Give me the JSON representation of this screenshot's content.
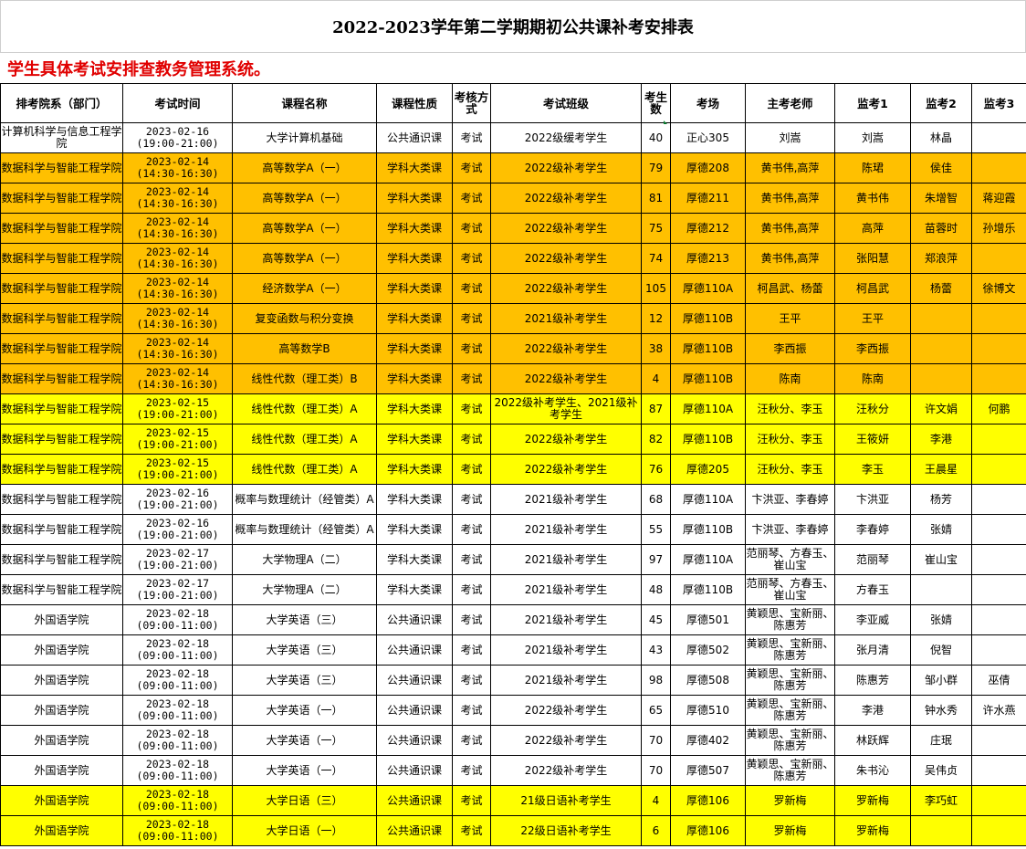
{
  "title": "2022-2023学年第二学期期初公共课补考安排表",
  "notice": "学生具体考试安排查教务管理系统。",
  "headers": [
    "排考院系（部门）",
    "考试时间",
    "课程名称",
    "课程性质",
    "考核方式",
    "考试班级",
    "考生数",
    "考场",
    "主考老师",
    "监考1",
    "监考2",
    "监考3"
  ],
  "rows": [
    {
      "color": "white",
      "dept": "计算机科学与信息工程学院",
      "date": "2023-02-16",
      "time": "(19:00-21:00)",
      "course": "大学计算机基础",
      "nature": "公共通识课",
      "method": "考试",
      "cls": "2022级缓考学生",
      "count": "40",
      "room": "正心305",
      "examiner": "刘嵩",
      "p1": "刘嵩",
      "p2": "林晶",
      "p3": ""
    },
    {
      "color": "orange",
      "dept": "数据科学与智能工程学院",
      "date": "2023-02-14",
      "time": "(14:30-16:30)",
      "course": "高等数学A（一）",
      "nature": "学科大类课",
      "method": "考试",
      "cls": "2022级补考学生",
      "count": "79",
      "room": "厚德208",
      "examiner": "黄书伟,高萍",
      "p1": "陈珺",
      "p2": "侯佳",
      "p3": ""
    },
    {
      "color": "orange",
      "dept": "数据科学与智能工程学院",
      "date": "2023-02-14",
      "time": "(14:30-16:30)",
      "course": "高等数学A（一）",
      "nature": "学科大类课",
      "method": "考试",
      "cls": "2022级补考学生",
      "count": "81",
      "room": "厚德211",
      "examiner": "黄书伟,高萍",
      "p1": "黄书伟",
      "p2": "朱增智",
      "p3": "蒋迎霞"
    },
    {
      "color": "orange",
      "dept": "数据科学与智能工程学院",
      "date": "2023-02-14",
      "time": "(14:30-16:30)",
      "course": "高等数学A（一）",
      "nature": "学科大类课",
      "method": "考试",
      "cls": "2022级补考学生",
      "count": "75",
      "room": "厚德212",
      "examiner": "黄书伟,高萍",
      "p1": "高萍",
      "p2": "苗蓉时",
      "p3": "孙增乐"
    },
    {
      "color": "orange",
      "dept": "数据科学与智能工程学院",
      "date": "2023-02-14",
      "time": "(14:30-16:30)",
      "course": "高等数学A（一）",
      "nature": "学科大类课",
      "method": "考试",
      "cls": "2022级补考学生",
      "count": "74",
      "room": "厚德213",
      "examiner": "黄书伟,高萍",
      "p1": "张阳慧",
      "p2": "郑浪萍",
      "p3": ""
    },
    {
      "color": "orange",
      "dept": "数据科学与智能工程学院",
      "date": "2023-02-14",
      "time": "(14:30-16:30)",
      "course": "经济数学A（一）",
      "nature": "学科大类课",
      "method": "考试",
      "cls": "2022级补考学生",
      "count": "105",
      "room": "厚德110A",
      "examiner": "柯昌武、杨蕾",
      "p1": "柯昌武",
      "p2": "杨蕾",
      "p3": "徐博文"
    },
    {
      "color": "orange",
      "dept": "数据科学与智能工程学院",
      "date": "2023-02-14",
      "time": "(14:30-16:30)",
      "course": "复变函数与积分变换",
      "nature": "学科大类课",
      "method": "考试",
      "cls": "2021级补考学生",
      "count": "12",
      "room": "厚德110B",
      "examiner": "王平",
      "p1": "王平",
      "p2": "",
      "p3": ""
    },
    {
      "color": "orange",
      "dept": "数据科学与智能工程学院",
      "date": "2023-02-14",
      "time": "(14:30-16:30)",
      "course": "高等数学B",
      "nature": "学科大类课",
      "method": "考试",
      "cls": "2022级补考学生",
      "count": "38",
      "room": "厚德110B",
      "examiner": "李西振",
      "p1": "李西振",
      "p2": "",
      "p3": ""
    },
    {
      "color": "orange",
      "dept": "数据科学与智能工程学院",
      "date": "2023-02-14",
      "time": "(14:30-16:30)",
      "course": "线性代数（理工类）B",
      "nature": "学科大类课",
      "method": "考试",
      "cls": "2022级补考学生",
      "count": "4",
      "room": "厚德110B",
      "examiner": "陈南",
      "p1": "陈南",
      "p2": "",
      "p3": ""
    },
    {
      "color": "yellow",
      "dept": "数据科学与智能工程学院",
      "date": "2023-02-15",
      "time": "(19:00-21:00)",
      "course": "线性代数（理工类）A",
      "nature": "学科大类课",
      "method": "考试",
      "cls": "2022级补考学生、2021级补考学生",
      "count": "87",
      "room": "厚德110A",
      "examiner": "汪秋分、李玉",
      "p1": "汪秋分",
      "p2": "许文娟",
      "p3": "何鹏"
    },
    {
      "color": "yellow",
      "dept": "数据科学与智能工程学院",
      "date": "2023-02-15",
      "time": "(19:00-21:00)",
      "course": "线性代数（理工类）A",
      "nature": "学科大类课",
      "method": "考试",
      "cls": "2022级补考学生",
      "count": "82",
      "room": "厚德110B",
      "examiner": "汪秋分、李玉",
      "p1": "王筱妍",
      "p2": "李港",
      "p3": ""
    },
    {
      "color": "yellow",
      "dept": "数据科学与智能工程学院",
      "date": "2023-02-15",
      "time": "(19:00-21:00)",
      "course": "线性代数（理工类）A",
      "nature": "学科大类课",
      "method": "考试",
      "cls": "2022级补考学生",
      "count": "76",
      "room": "厚德205",
      "examiner": "汪秋分、李玉",
      "p1": "李玉",
      "p2": "王晨星",
      "p3": ""
    },
    {
      "color": "white",
      "dept": "数据科学与智能工程学院",
      "date": "2023-02-16",
      "time": "(19:00-21:00)",
      "course": "概率与数理统计（经管类）A",
      "nature": "学科大类课",
      "method": "考试",
      "cls": "2021级补考学生",
      "count": "68",
      "room": "厚德110A",
      "examiner": "卞洪亚、李春婷",
      "p1": "卞洪亚",
      "p2": "杨芳",
      "p3": ""
    },
    {
      "color": "white",
      "dept": "数据科学与智能工程学院",
      "date": "2023-02-16",
      "time": "(19:00-21:00)",
      "course": "概率与数理统计（经管类）A",
      "nature": "学科大类课",
      "method": "考试",
      "cls": "2021级补考学生",
      "count": "55",
      "room": "厚德110B",
      "examiner": "卞洪亚、李春婷",
      "p1": "李春婷",
      "p2": "张婧",
      "p3": ""
    },
    {
      "color": "white",
      "dept": "数据科学与智能工程学院",
      "date": "2023-02-17",
      "time": "(19:00-21:00)",
      "course": "大学物理A（二）",
      "nature": "学科大类课",
      "method": "考试",
      "cls": "2021级补考学生",
      "count": "97",
      "room": "厚德110A",
      "examiner": "范丽琴、方春玉、崔山宝",
      "p1": "范丽琴",
      "p2": "崔山宝",
      "p3": ""
    },
    {
      "color": "white",
      "dept": "数据科学与智能工程学院",
      "date": "2023-02-17",
      "time": "(19:00-21:00)",
      "course": "大学物理A（二）",
      "nature": "学科大类课",
      "method": "考试",
      "cls": "2021级补考学生",
      "count": "48",
      "room": "厚德110B",
      "examiner": "范丽琴、方春玉、崔山宝",
      "p1": "方春玉",
      "p2": "",
      "p3": ""
    },
    {
      "color": "white",
      "dept": "外国语学院",
      "date": "2023-02-18",
      "time": "(09:00-11:00)",
      "course": "大学英语（三）",
      "nature": "公共通识课",
      "method": "考试",
      "cls": "2021级补考学生",
      "count": "45",
      "room": "厚德501",
      "examiner": "黄颖思、宝新丽、陈惠芳",
      "p1": "李亚威",
      "p2": "张婧",
      "p3": ""
    },
    {
      "color": "white",
      "dept": "外国语学院",
      "date": "2023-02-18",
      "time": "(09:00-11:00)",
      "course": "大学英语（三）",
      "nature": "公共通识课",
      "method": "考试",
      "cls": "2021级补考学生",
      "count": "43",
      "room": "厚德502",
      "examiner": "黄颖思、宝新丽、陈惠芳",
      "p1": "张月清",
      "p2": "倪智",
      "p3": ""
    },
    {
      "color": "white",
      "dept": "外国语学院",
      "date": "2023-02-18",
      "time": "(09:00-11:00)",
      "course": "大学英语（三）",
      "nature": "公共通识课",
      "method": "考试",
      "cls": "2021级补考学生",
      "count": "98",
      "room": "厚德508",
      "examiner": "黄颖思、宝新丽、陈惠芳",
      "p1": "陈惠芳",
      "p2": "邹小群",
      "p3": "巫倩"
    },
    {
      "color": "white",
      "dept": "外国语学院",
      "date": "2023-02-18",
      "time": "(09:00-11:00)",
      "course": "大学英语（一）",
      "nature": "公共通识课",
      "method": "考试",
      "cls": "2022级补考学生",
      "count": "65",
      "room": "厚德510",
      "examiner": "黄颖思、宝新丽、陈惠芳",
      "p1": "李港",
      "p2": "钟水秀",
      "p3": "许水燕"
    },
    {
      "color": "white",
      "dept": "外国语学院",
      "date": "2023-02-18",
      "time": "(09:00-11:00)",
      "course": "大学英语（一）",
      "nature": "公共通识课",
      "method": "考试",
      "cls": "2022级补考学生",
      "count": "70",
      "room": "厚德402",
      "examiner": "黄颖思、宝新丽、陈惠芳",
      "p1": "林跃辉",
      "p2": "庄珉",
      "p3": ""
    },
    {
      "color": "white",
      "dept": "外国语学院",
      "date": "2023-02-18",
      "time": "(09:00-11:00)",
      "course": "大学英语（一）",
      "nature": "公共通识课",
      "method": "考试",
      "cls": "2022级补考学生",
      "count": "70",
      "room": "厚德507",
      "examiner": "黄颖思、宝新丽、陈惠芳",
      "p1": "朱书沁",
      "p2": "吴伟贞",
      "p3": ""
    },
    {
      "color": "yellow",
      "dept": "外国语学院",
      "date": "2023-02-18",
      "time": "(09:00-11:00)",
      "course": "大学日语（三）",
      "nature": "公共通识课",
      "method": "考试",
      "cls": "21级日语补考学生",
      "count": "4",
      "room": "厚德106",
      "examiner": "罗新梅",
      "p1": "罗新梅",
      "p2": "李巧虹",
      "p3": ""
    },
    {
      "color": "yellow",
      "dept": "外国语学院",
      "date": "2023-02-18",
      "time": "(09:00-11:00)",
      "course": "大学日语（一）",
      "nature": "公共通识课",
      "method": "考试",
      "cls": "22级日语补考学生",
      "count": "6",
      "room": "厚德106",
      "examiner": "罗新梅",
      "p1": "罗新梅",
      "p2": "",
      "p3": ""
    }
  ],
  "colors": {
    "orange": "#ffc000",
    "yellow": "#ffff00",
    "white": "#ffffff",
    "notice": "#e00000"
  }
}
